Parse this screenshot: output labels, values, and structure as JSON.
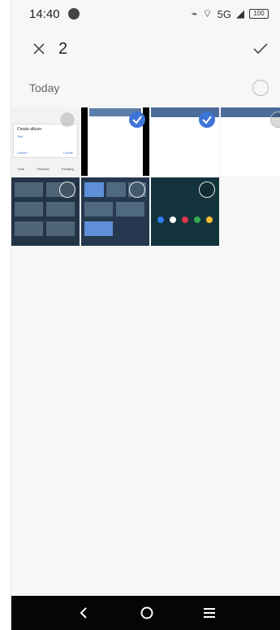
{
  "status": {
    "time": "14:40",
    "network": "5G",
    "battery": "100"
  },
  "toolbar": {
    "selected_count": "2"
  },
  "section": {
    "title": "Today"
  },
  "thumbnails": {
    "album_dialog_title": "Create album",
    "album_dialog_value": "Test",
    "album_dialog_cancel": "Cancel",
    "album_dialog_create": "Create",
    "tabs": [
      "Tune",
      "Trimmed",
      "Trending"
    ]
  },
  "colors": {
    "accent": "#3d74d8",
    "nav_bar": "#050505"
  }
}
